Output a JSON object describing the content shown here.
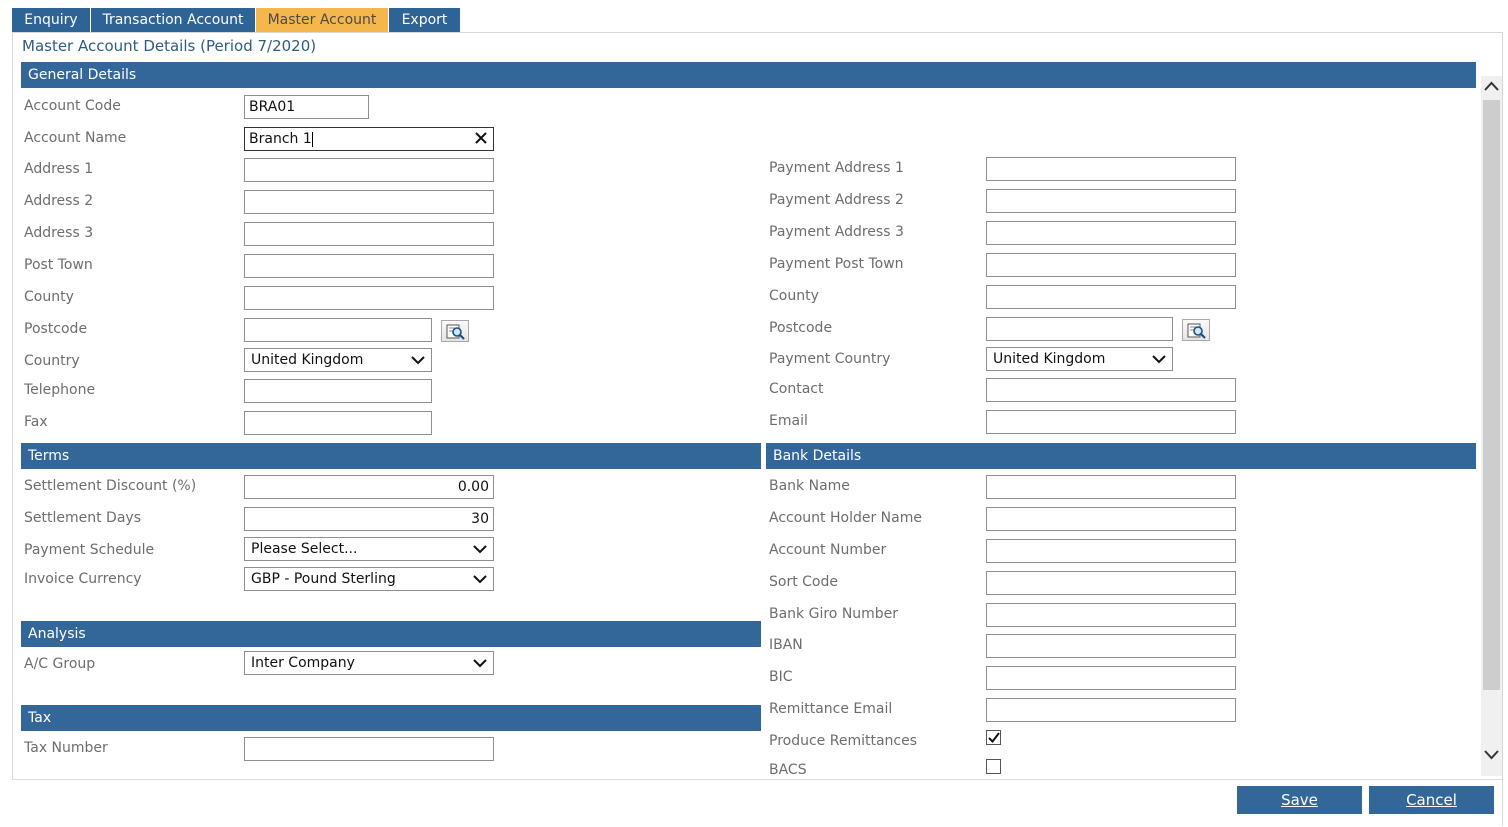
{
  "tabs": {
    "enquiry": "Enquiry",
    "transaction": "Transaction Account",
    "master": "Master Account",
    "export": "Export"
  },
  "page_title": "Master Account Details (Period 7/2020)",
  "sections": {
    "general": "General Details",
    "terms": "Terms",
    "bank": "Bank Details",
    "analysis": "Analysis",
    "tax": "Tax"
  },
  "general": {
    "account_code": {
      "label": "Account Code",
      "value": "BRA01"
    },
    "account_name": {
      "label": "Account Name",
      "value": "Branch 1"
    },
    "address1": {
      "label": "Address 1",
      "value": ""
    },
    "address2": {
      "label": "Address 2",
      "value": ""
    },
    "address3": {
      "label": "Address 3",
      "value": ""
    },
    "post_town": {
      "label": "Post Town",
      "value": ""
    },
    "county": {
      "label": "County",
      "value": ""
    },
    "postcode": {
      "label": "Postcode",
      "value": ""
    },
    "country": {
      "label": "Country",
      "value": "United Kingdom"
    },
    "telephone": {
      "label": "Telephone",
      "value": ""
    },
    "fax": {
      "label": "Fax",
      "value": ""
    },
    "pay_address1": {
      "label": "Payment Address 1",
      "value": ""
    },
    "pay_address2": {
      "label": "Payment Address 2",
      "value": ""
    },
    "pay_address3": {
      "label": "Payment Address 3",
      "value": ""
    },
    "pay_post_town": {
      "label": "Payment Post Town",
      "value": ""
    },
    "pay_county": {
      "label": "County",
      "value": ""
    },
    "pay_postcode": {
      "label": "Postcode",
      "value": ""
    },
    "pay_country": {
      "label": "Payment Country",
      "value": "United Kingdom"
    },
    "contact": {
      "label": "Contact",
      "value": ""
    },
    "email": {
      "label": "Email",
      "value": ""
    }
  },
  "terms": {
    "settlement_discount": {
      "label": "Settlement Discount (%)",
      "value": "0.00"
    },
    "settlement_days": {
      "label": "Settlement Days",
      "value": "30"
    },
    "payment_schedule": {
      "label": "Payment Schedule",
      "value": "Please Select..."
    },
    "invoice_currency": {
      "label": "Invoice Currency",
      "value": "GBP - Pound Sterling"
    }
  },
  "analysis": {
    "ac_group": {
      "label": "A/C Group",
      "value": "Inter Company"
    }
  },
  "tax": {
    "tax_number": {
      "label": "Tax Number",
      "value": ""
    }
  },
  "bank": {
    "bank_name": {
      "label": "Bank Name",
      "value": ""
    },
    "holder_name": {
      "label": "Account Holder Name",
      "value": ""
    },
    "account_number": {
      "label": "Account Number",
      "value": ""
    },
    "sort_code": {
      "label": "Sort Code",
      "value": ""
    },
    "giro": {
      "label": "Bank Giro Number",
      "value": ""
    },
    "iban": {
      "label": "IBAN",
      "value": ""
    },
    "bic": {
      "label": "BIC",
      "value": ""
    },
    "remit_email": {
      "label": "Remittance Email",
      "value": ""
    },
    "produce_remittances": {
      "label": "Produce Remittances",
      "checked": true
    },
    "bacs": {
      "label": "BACS",
      "checked": false
    }
  },
  "buttons": {
    "save": "Save",
    "cancel": "Cancel"
  },
  "colors": {
    "tab_bg": "#2e6395",
    "tab_active_bg": "#f5b74c",
    "section_bar": "#336799",
    "button_bg": "#336799"
  },
  "icons": {
    "lookup": "magnifier-lookup-icon",
    "clear": "close-icon",
    "dropdown": "chevron-down-icon",
    "check": "checkmark-icon"
  }
}
